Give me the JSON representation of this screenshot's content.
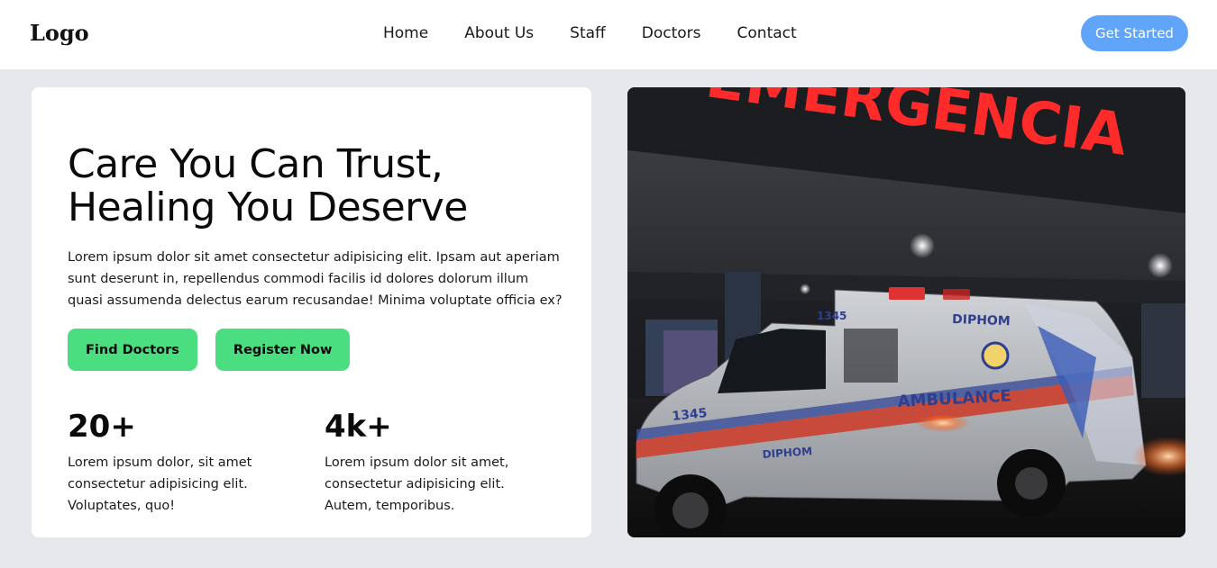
{
  "navbar": {
    "logo": "Logo",
    "links": [
      "Home",
      "About Us",
      "Staff",
      "Doctors",
      "Contact"
    ],
    "cta": "Get Started"
  },
  "hero": {
    "title_line1": "Care You Can Trust,",
    "title_line2": "Healing You Deserve",
    "description": "Lorem ipsum dolor sit amet consectetur adipisicing elit. Ipsam aut aperiam sunt deserunt in, repellendus commodi facilis id dolores dolorum illum quasi assumenda delectus earum recusandae! Minima voluptate officia ex?",
    "buttons": {
      "find_doctors": "Find Doctors",
      "register": "Register Now"
    },
    "stats": [
      {
        "value": "20+",
        "text": "Lorem ipsum dolor, sit amet consectetur adipisicing elit. Voluptates, quo!"
      },
      {
        "value": "4k+",
        "text": "Lorem ipsum dolor sit amet, consectetur adipisicing elit. Autem, temporibus."
      }
    ]
  },
  "image": {
    "sign": "EMERGENCIA",
    "ambulance_text": "AMBULANCE",
    "ambulance_brand": "DIPHOM",
    "ambulance_number": "1345"
  },
  "colors": {
    "accent_blue": "#60a5fa",
    "accent_green": "#4ade80",
    "page_bg": "#e5e7eb",
    "sign_red": "#ff2a2a"
  }
}
